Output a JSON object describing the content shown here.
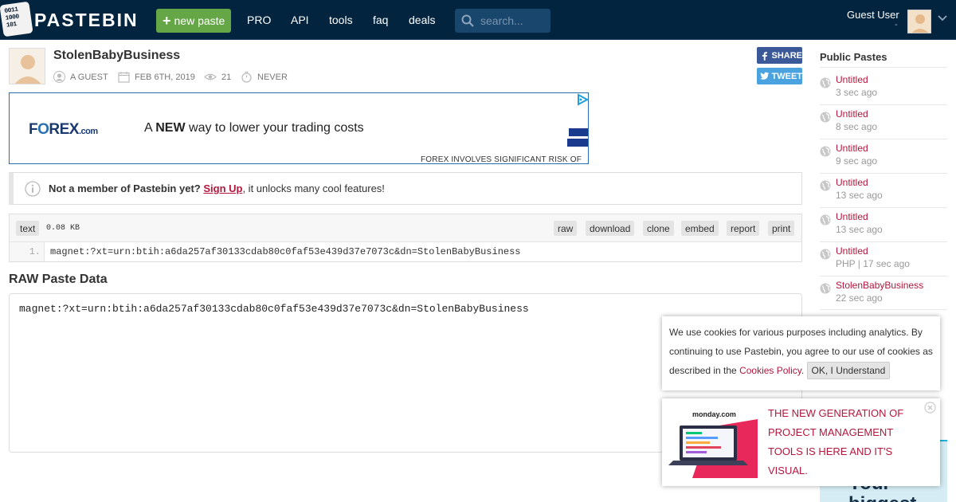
{
  "header": {
    "logo_bits": [
      "0011",
      "1000",
      "101"
    ],
    "logo_text": "PASTEBIN",
    "new_paste": "new paste",
    "nav": [
      "PRO",
      "API",
      "tools",
      "faq",
      "deals"
    ],
    "search_placeholder": "search...",
    "user_name": "Guest User",
    "user_sub": "-"
  },
  "paste": {
    "title": "StolenBabyBusiness",
    "author": "A GUEST",
    "date": "FEB 6TH, 2019",
    "views": "21",
    "expires": "NEVER",
    "share": "SHARE",
    "tweet": "TWEET"
  },
  "ad_banner": {
    "brand_main": "F",
    "brand_o": "O",
    "brand_rest": "REX",
    "brand_tld": ".com",
    "text_a": "A ",
    "text_b": "NEW",
    "text_c": " way to lower your trading costs",
    "disclaimer": "FOREX INVOLVES SIGNIFICANT RISK OF LOSS"
  },
  "notice": {
    "bold": "Not a member of Pastebin yet?",
    "link": "Sign Up",
    "rest": ", it unlocks many cool features!"
  },
  "code": {
    "syntax": "text",
    "size": "0.08 KB",
    "actions": [
      "raw",
      "download",
      "clone",
      "embed",
      "report",
      "print"
    ],
    "line_number": "1.",
    "line": "magnet:?xt=urn:btih:a6da257af30133cdab80c0faf53e439d37e7073c&dn=StolenBabyBusiness"
  },
  "raw": {
    "heading": "RAW Paste Data",
    "content": "magnet:?xt=urn:btih:a6da257af30133cdab80c0faf53e439d37e7073c&dn=StolenBabyBusiness"
  },
  "sidebar": {
    "title": "Public Pastes",
    "items": [
      {
        "title": "Untitled",
        "meta": "3 sec ago"
      },
      {
        "title": "Untitled",
        "meta": "8 sec ago"
      },
      {
        "title": "Untitled",
        "meta": "9 sec ago"
      },
      {
        "title": "Untitled",
        "meta": "13 sec ago"
      },
      {
        "title": "Untitled",
        "meta": "13 sec ago"
      },
      {
        "title": "Untitled",
        "meta": "PHP | 17 sec ago"
      },
      {
        "title": "StolenBabyBusiness",
        "meta": "22 sec ago"
      }
    ],
    "ad_text": "Your biggest"
  },
  "cookie": {
    "text": "We use cookies for various purposes including analytics. By continuing to use Pastebin, you agree to our use of cookies as described in the ",
    "link": "Cookies Policy",
    "after": ". ",
    "button": "OK, I Understand"
  },
  "promo": {
    "logo": "monday.com",
    "text": "THE NEW GENERATION OF PROJECT MANAGEMENT TOOLS IS HERE AND IT'S VISUAL."
  },
  "colors": {
    "header_bg": "#02243e",
    "accent_green": "#65a746",
    "link_red": "#b4163c",
    "facebook": "#3b5998",
    "twitter": "#4aa3df"
  }
}
